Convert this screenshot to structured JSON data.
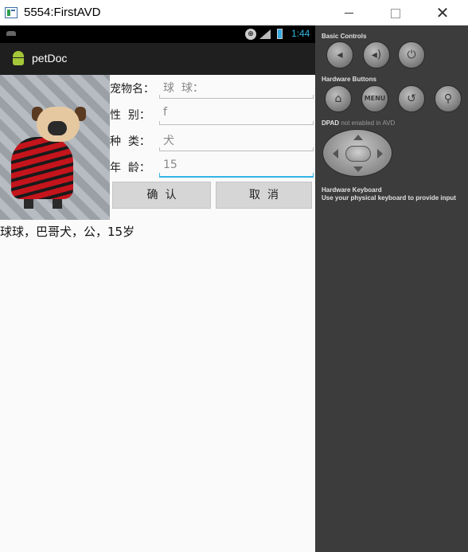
{
  "window": {
    "title": "5554:FirstAVD"
  },
  "statusbar": {
    "time": "1:44",
    "network": "3G"
  },
  "actionbar": {
    "title": "petDoc"
  },
  "form": {
    "name_label": "宠物名：",
    "name_value": "球  球：",
    "gender_label": "性  别：",
    "gender_value": "f",
    "species_label": "种  类：",
    "species_value": "犬",
    "age_label": "年  龄：",
    "age_value": "15",
    "confirm_label": "确  认",
    "cancel_label": "取  消"
  },
  "result": {
    "text": "球球，巴哥犬，公，15岁"
  },
  "controls": {
    "basic_controls_title": "Basic Controls",
    "hardware_buttons_title": "Hardware Buttons",
    "menu_label": "MENU",
    "dpad_title": "DPAD",
    "dpad_note": "not enabled in AVD",
    "keyboard_title": "Hardware Keyboard",
    "keyboard_note": "Use your physical keyboard to provide input"
  },
  "colors": {
    "accent": "#33b5e5",
    "android_green": "#a4c639",
    "panel_bg": "#3c3c3c"
  },
  "icons": [
    "app-icon",
    "minimize-icon",
    "maximize-icon",
    "close-icon",
    "notification-icon",
    "signal-icon",
    "battery-icon",
    "android-icon",
    "volume-down-icon",
    "volume-up-icon",
    "power-icon",
    "home-icon",
    "back-icon",
    "search-icon"
  ]
}
